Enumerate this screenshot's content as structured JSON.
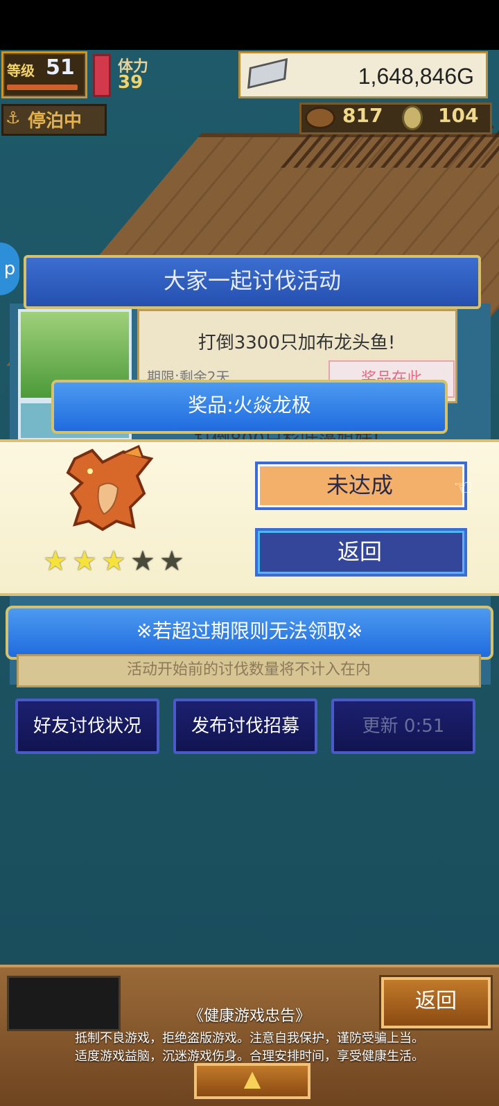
{
  "hud": {
    "level_label": "等级",
    "level_value": "51",
    "stamina_label": "体力",
    "stamina_value": "39",
    "gold_value": "1,648,846G",
    "moor_label": "停泊中",
    "wood_value": "817",
    "coin_value": "104"
  },
  "event": {
    "title": "大家一起讨伐活动",
    "quest_text": "打倒3300只加布龙头鱼!",
    "quest_sub": "期限:剩余2天",
    "reward_tag": "奖品在此",
    "quest_text2": "打倒800只杉叶藻姐妹!"
  },
  "dialog": {
    "prize_title": "奖品:火焱龙极",
    "status_button": "未达成",
    "back_button": "返回",
    "rating_stars": 3,
    "rating_max": 5,
    "star_glyph": "★"
  },
  "notice": {
    "text": "※若超过期限则无法领取※",
    "footer_text": "活动开始前的讨伐数量将不计入在内"
  },
  "nav": {
    "friends": "好友讨伐状况",
    "recruit": "发布讨伐招募",
    "refresh": "更新 0:51"
  },
  "bottom": {
    "back_button": "返回",
    "health_title": "《健康游戏忠告》",
    "health_line1": "抵制不良游戏，拒绝盗版游戏。注意自我保护，谨防受骗上当。",
    "health_line2": "适度游戏益脑，沉迷游戏伤身。合理安排时间，享受健康生活。",
    "up_arrow": "▲"
  },
  "colors": {
    "star_filled": "#f6e23a",
    "star_empty": "#4a4a3a",
    "button_blue": "#1f6be0",
    "status_orange": "#f2b06a"
  }
}
